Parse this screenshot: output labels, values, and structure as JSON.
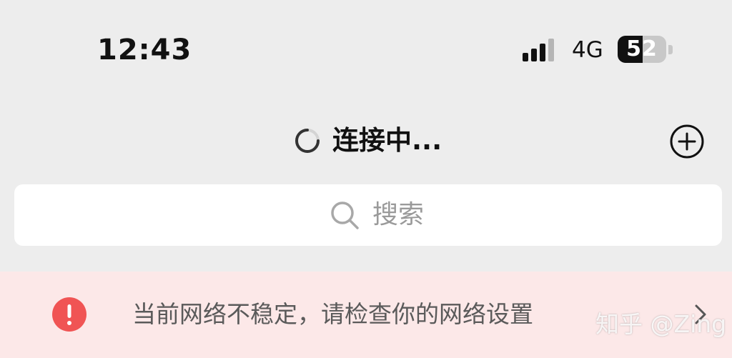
{
  "status_bar": {
    "time": "12:43",
    "signal_icon": "cellular-signal-icon",
    "network": "4G",
    "battery_level": "52",
    "battery_fraction": 0.52
  },
  "header": {
    "spinner_icon": "loading-spinner-icon",
    "title": "连接中...",
    "add_icon": "plus-circle-icon"
  },
  "search": {
    "icon": "search-icon",
    "placeholder": "搜索"
  },
  "banner": {
    "icon": "exclamation-circle-icon",
    "message": "当前网络不稳定，请检查你的网络设置",
    "chevron_icon": "chevron-right-icon",
    "alert_color": "#f05454"
  },
  "watermark": "知乎 @Zing"
}
